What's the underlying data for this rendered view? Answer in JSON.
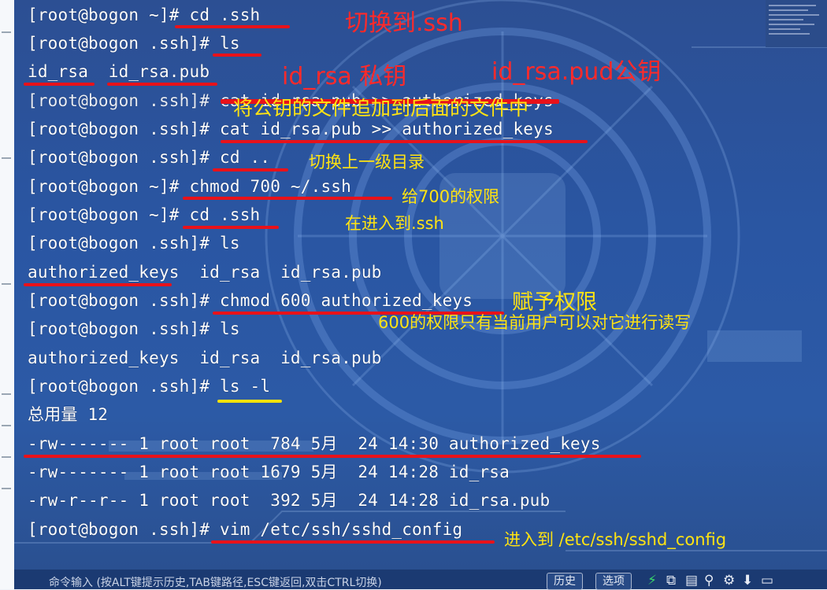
{
  "terminal": {
    "lines": [
      "[root@bogon ~]# cd .ssh",
      "[root@bogon .ssh]# ls",
      "id_rsa  id_rsa.pub",
      "[root@bogon .ssh]# cat id_rsa.pub >> authorized_keys",
      "[root@bogon .ssh]# cat id_rsa.pub >> authorized_keys",
      "[root@bogon .ssh]# cd ..",
      "[root@bogon ~]# chmod 700 ~/.ssh",
      "[root@bogon ~]# cd .ssh",
      "[root@bogon .ssh]# ls",
      "authorized_keys  id_rsa  id_rsa.pub",
      "[root@bogon .ssh]# chmod 600 authorized_keys",
      "[root@bogon .ssh]# ls",
      "authorized_keys  id_rsa  id_rsa.pub",
      "[root@bogon .ssh]# ls -l",
      "总用量 12",
      "-rw------- 1 root root  784 5月  24 14:30 authorized_keys",
      "-rw------- 1 root root 1679 5月  24 14:28 id_rsa",
      "-rw-r--r-- 1 root root  392 5月  24 14:28 id_rsa.pub",
      "[root@bogon .ssh]# vim /etc/ssh/sshd_config"
    ]
  },
  "annotations": {
    "switch_to_ssh": "切换到.ssh",
    "private_key": "id_rsa  私钥",
    "public_key": "id_rsa.pud公钥",
    "append_pubkey": "将公钥的文件追加到后面的文件中",
    "go_up": "切换上一级目录",
    "give_700": "给700的权限",
    "enter_ssh": "在进入到.ssh",
    "grant_perm": "赋予权限",
    "perm_600_desc": "600的权限只有当前用户可以对它进行读写",
    "enter_sshd_config": "进入到 /etc/ssh/sshd_config"
  },
  "status_bar": {
    "hint": "命令输入 (按ALT键提示历史,TAB键路径,ESC键返回,双击CTRL切换)",
    "history_button": "历史",
    "options_button": "选项",
    "icons": [
      "lightning-icon",
      "copy-icon",
      "file-icon",
      "search-icon",
      "gear-icon",
      "download-icon",
      "window-icon"
    ]
  },
  "colors": {
    "terminal_bg": "#2a56a3",
    "annotation_red": "#ff2a2a",
    "annotation_yellow": "#ffe312",
    "underline_red": "#e8121a",
    "underline_yellow": "#f2e10a"
  }
}
